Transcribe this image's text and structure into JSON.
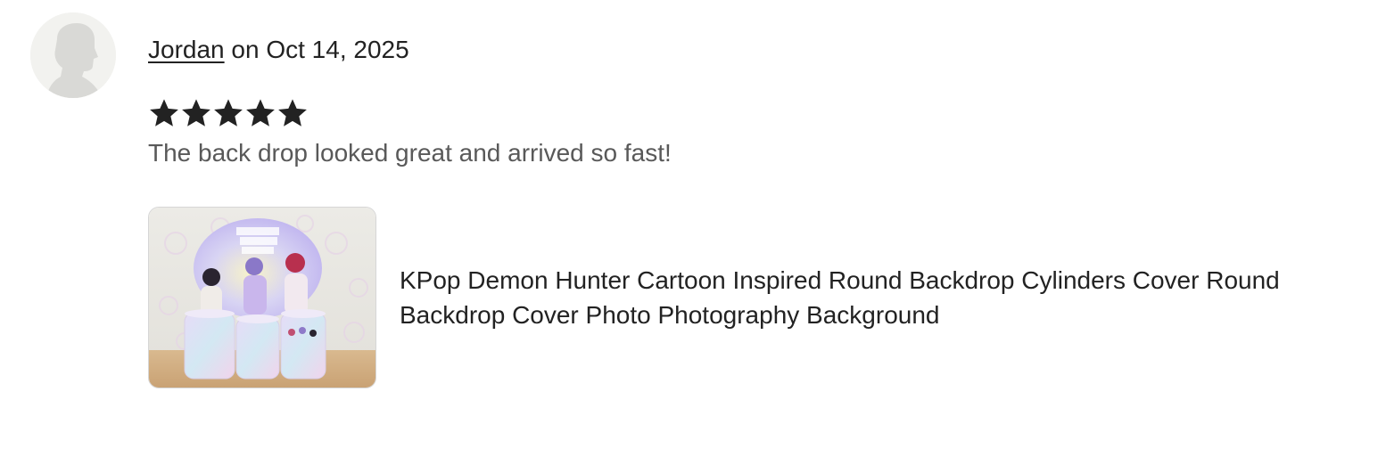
{
  "review": {
    "reviewer_name": "Jordan",
    "date_text": "on Oct 14, 2025",
    "rating": 5,
    "rating_max": 5,
    "text": "The back drop looked great and arrived so fast!"
  },
  "product": {
    "title": "KPop Demon Hunter Cartoon Inspired Round Backdrop Cylinders Cover Round Backdrop Cover Photo Photography Background"
  },
  "icons": {
    "avatar": "default-avatar-silhouette-icon",
    "star": "star-filled-icon"
  },
  "colors": {
    "star": "#222222",
    "text_primary": "#222222",
    "text_secondary": "#595959",
    "avatar_bg": "#f2f2ef",
    "avatar_silhouette": "#d9d9d6"
  }
}
